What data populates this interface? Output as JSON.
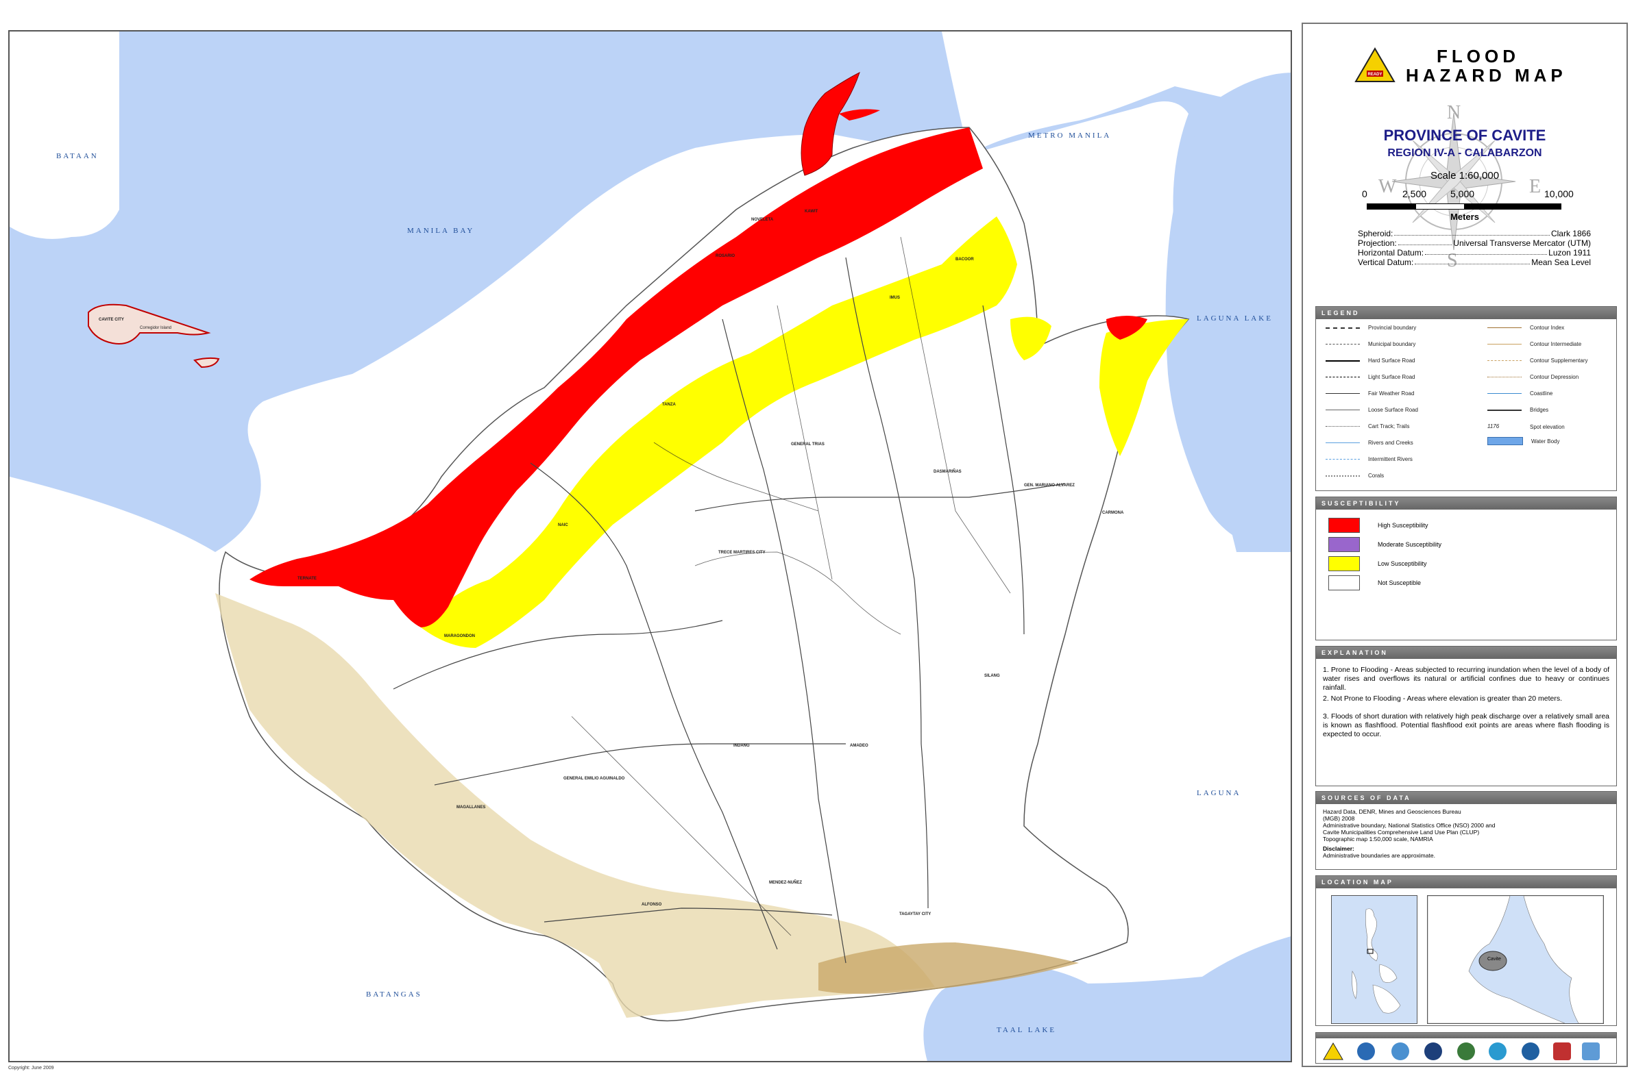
{
  "title": {
    "line1": "FLOOD",
    "line2": "HAZARD MAP",
    "logo_text": "READY"
  },
  "province": "PROVINCE OF CAVITE",
  "region": "REGION IV-A - CALABARZON",
  "scale": {
    "label": "Scale 1:60,000",
    "ticks": [
      "0",
      "2,500",
      "5,000",
      "10,000"
    ],
    "unit": "Meters"
  },
  "compass": {
    "n": "N",
    "s": "S",
    "e": "E",
    "w": "W"
  },
  "datum": [
    {
      "key": "Spheroid:",
      "value": "Clark 1866"
    },
    {
      "key": "Projection:",
      "value": "Universal Transverse Mercator (UTM)"
    },
    {
      "key": "Horizontal Datum:",
      "value": "Luzon 1911"
    },
    {
      "key": "Vertical Datum:",
      "value": "Mean Sea Level"
    }
  ],
  "legend": {
    "header": "LEGEND",
    "left": [
      "Provincial boundary",
      "Municipal boundary",
      "Hard Surface Road",
      "Light Surface Road",
      "Fair Weather Road",
      "Loose Surface Road",
      "Cart Track; Trails",
      "Rivers and Creeks",
      "Intermittent Rivers",
      "Corals"
    ],
    "right": [
      "Contour Index",
      "Contour Intermediate",
      "Contour Supplementary",
      "Contour Depression",
      "Coastline",
      "Bridges",
      "Spot elevation",
      "Water Body"
    ],
    "spot_value": "1176"
  },
  "susceptibility": {
    "header": "SUSCEPTIBILITY",
    "items": [
      {
        "label": "High Susceptibility",
        "color": "#ff0000"
      },
      {
        "label": "Moderate Susceptibility",
        "color": "#9966cc"
      },
      {
        "label": "Low Susceptibility",
        "color": "#ffff00"
      },
      {
        "label": "Not Susceptible",
        "color": "#ffffff"
      }
    ]
  },
  "explanation": {
    "header": "EXPLANATION",
    "items": [
      "1. Prone to Flooding - Areas subjected to recurring inundation when the level of a body of water rises and overflows its natural or artificial confines due to heavy or continues rainfall.",
      "2. Not Prone to Flooding - Areas where elevation is greater than 20 meters.",
      "3. Floods of short duration with relatively high peak discharge over a relatively small area is known as flashflood. Potential flashflood exit points are areas where flash flooding is expected to occur."
    ]
  },
  "sources": {
    "header": "SOURCES OF DATA",
    "lines": [
      "Hazard Data, DENR, Mines and Geosciences Bureau",
      "(MGB) 2008",
      "Administrative boundary, National Statistics Office (NSO) 2000 and",
      "Cavite Municipalities Comprehensive Land Use Plan (CLUP)",
      "Topographic map 1:50,000 scale,  NAMRIA"
    ],
    "disclaimer_title": "Disclaimer:",
    "disclaimer": "Administrative boundaries are approximate."
  },
  "location_map": {
    "header": "LOCATION MAP",
    "inset_label": "Cavite"
  },
  "map_labels": {
    "bataan": "BATAAN",
    "manila_bay": "MANILA BAY",
    "metro_manila": "METRO MANILA",
    "laguna_lake": "LAGUNA LAKE",
    "laguna": "LAGUNA",
    "batangas": "BATANGAS",
    "taal_lake": "TAAL LAKE"
  },
  "places": [
    "CAVITE CITY",
    "NOVELETA",
    "ROSARIO",
    "KAWIT",
    "BACOOR",
    "IMUS",
    "TANZA",
    "GENERAL TRIAS",
    "DASMARIÑAS",
    "GEN. MARIANO ALVAREZ",
    "CARMONA",
    "NAIC",
    "TRECE MARTIRES CITY",
    "TERNATE",
    "MARAGONDON",
    "SILANG",
    "AMADEO",
    "INDANG",
    "GENERAL EMILIO AGUINALDO",
    "MAGALLANES",
    "ALFONSO",
    "MENDEZ-NUÑEZ",
    "TAGAYTAY CITY",
    "Corregidor Island"
  ],
  "copyright": "Copyright: June 2009",
  "colors": {
    "water": "#bcd3f7",
    "high": "#ff0000",
    "low": "#ffff00",
    "land": "#ffffff",
    "upland": "#dcc48e"
  }
}
